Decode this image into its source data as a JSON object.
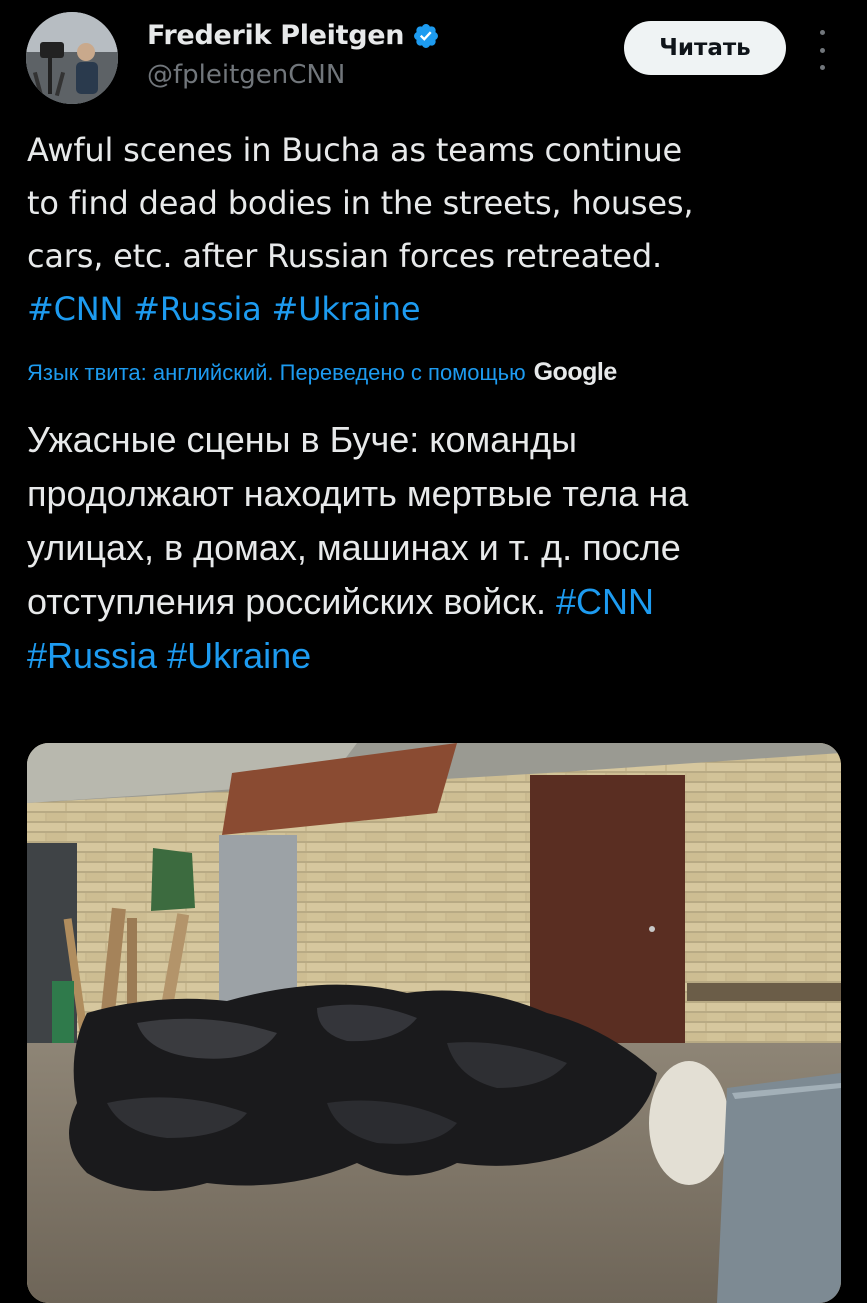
{
  "author": {
    "name": "Frederik Pleitgen",
    "handle": "@fpleitgenCNN",
    "avatar_icon": "profile-photo",
    "verified_icon": "verified-badge-icon",
    "verified_color": "#1d9bf0"
  },
  "header": {
    "follow_label": "Читать",
    "more_icon": "more-vertical-icon"
  },
  "tweet": {
    "text_line_1": "Awful scenes in Bucha as teams continue",
    "text_line_2": "to find dead bodies in the streets, houses,",
    "text_line_3": "cars, etc. after Russian forces retreated.",
    "hashtags": [
      "#CNN",
      "#Russia",
      "#Ukraine"
    ]
  },
  "translation": {
    "note": "Язык твита: английский. Переведено с помощью",
    "provider": "Google",
    "text_line_1": "Ужасные сцены в Буче: команды",
    "text_line_2": "продолжают находить мертвые тела на",
    "text_line_3": "улицах, в домах, машинах и т. д. после",
    "text_line_4": "отступления российских войск.",
    "hashtags": [
      "#CNN",
      "#Russia",
      "#Ukraine"
    ]
  },
  "media": {
    "kind": "photo"
  },
  "colors": {
    "background": "#000000",
    "text": "#e7e9ea",
    "secondary_text": "#71767b",
    "accent": "#1d9bf0"
  }
}
